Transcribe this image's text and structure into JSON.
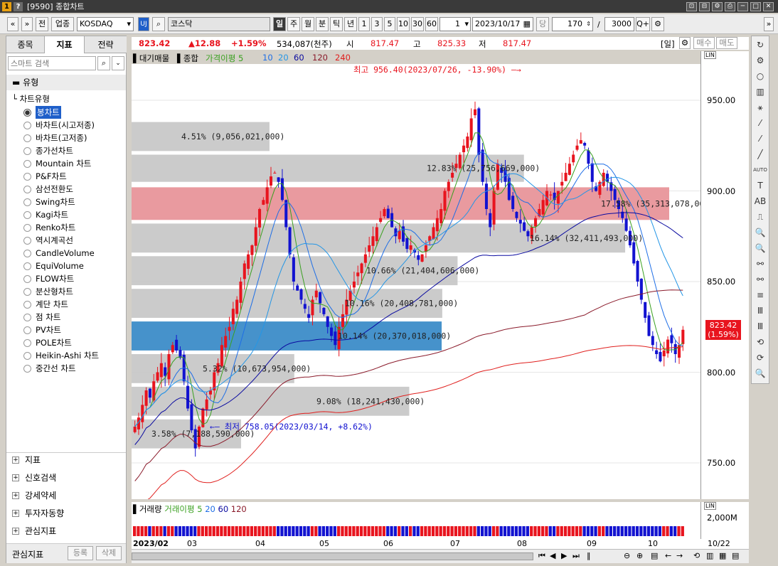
{
  "window": {
    "badge1": "1",
    "badge2": "?",
    "title": "[9590] 종합차트",
    "win_icons": [
      "⊡",
      "⊟",
      "⚙",
      "⎙",
      "─",
      "□",
      "✕"
    ]
  },
  "toolbar": {
    "nav_left": "«",
    "nav_down": "»",
    "btn_jeon": "전",
    "btn_upjong": "업종",
    "market_value": "KOSDAQ",
    "code_icon": "UJ",
    "search_icon": "⌕",
    "index_name": "코스닥",
    "periods": [
      "일",
      "주",
      "월",
      "분",
      "틱",
      "년"
    ],
    "counts": [
      "1",
      "3",
      "5",
      "10",
      "30",
      "60"
    ],
    "count_value": "1",
    "date_value": "2023/10/17",
    "btn_dang": "당",
    "view_count": "170",
    "slash": "/",
    "total_count": "3000",
    "zoom_icon": "Q+",
    "gear_icon": "⚙",
    "far_right": "»"
  },
  "leftpanel": {
    "tabs": [
      "종목",
      "지표",
      "전략"
    ],
    "search_placeholder": "스마트 검색",
    "group_label": "유형",
    "tree_label": "차트유형",
    "chart_types": [
      "봉차트",
      "바차트(시고저종)",
      "바차트(고저종)",
      "종가선차트",
      "Mountain 차트",
      "P&F차트",
      "삼선전환도",
      "Swing차트",
      "Kagi차트",
      "Renko차트",
      "역시계곡선",
      "CandleVolume",
      "EquiVolume",
      "FLOW차트",
      "분산형차트",
      "계단 차트",
      "점 차트",
      "PV차트",
      "POLE차트",
      "Heikin-Ashi 차트",
      "중간선 차트"
    ],
    "sections": [
      "지표",
      "신호검색",
      "강세약세",
      "투자자동향",
      "관심지표"
    ],
    "footer_label": "관심지표",
    "btn_register": "등록",
    "btn_delete": "삭제"
  },
  "infobar": {
    "price": "823.42",
    "change": "▲12.88",
    "pct": "+1.59%",
    "volume": "534,087(천주)",
    "open_label": "시",
    "open": "817.47",
    "high_label": "고",
    "high": "825.33",
    "low_label": "저",
    "low": "817.47",
    "period_tag": "[일]",
    "buy": "매수",
    "sell": "매도"
  },
  "legend": {
    "main": "▌대기매물",
    "composite": "▌종합",
    "ma_label": "가격이평 5",
    "ma10": "10",
    "ma20": "20",
    "ma60": "60",
    "ma120": "120",
    "ma240": "240"
  },
  "colors": {
    "up": "#e8141e",
    "down": "#1212d0",
    "ma5": "#3aa020",
    "ma10": "#1e6ee6",
    "ma20": "#2496e6",
    "ma60": "#0a0aa0",
    "ma120": "#8a1a2a",
    "ma240": "#e0201e",
    "profile": "#c8c8c8",
    "profile_hi": "#e8959a",
    "profile_cur": "#3c8cc8"
  },
  "chart_data": {
    "type": "candlestick",
    "ylim": [
      730,
      970
    ],
    "y_ticks": [
      "950.00",
      "900.00",
      "850.00",
      "800.00",
      "750.00"
    ],
    "y_tick_values": [
      950,
      900,
      850,
      800,
      750
    ],
    "months": [
      "2023/02",
      "03",
      "04",
      "05",
      "06",
      "07",
      "08",
      "09",
      "10"
    ],
    "right_date": "10/22",
    "current_price_label": "823.42",
    "current_pct_label": "(1.59%)",
    "annotations": {
      "high": "최고 956.40(2023/07/26, -13.90%)",
      "low": "최저 758.05(2023/03/14, +8.62%)"
    },
    "volume_profile": [
      {
        "lo": 922,
        "hi": 938,
        "pct": 4.51,
        "label": "4.51% (9,056,021,000)"
      },
      {
        "lo": 905,
        "hi": 920,
        "pct": 12.83,
        "label": "12.83% (25,756,669,000)"
      },
      {
        "lo": 884,
        "hi": 902,
        "pct": 17.58,
        "label": "17.58% (35,313,078,000)"
      },
      {
        "lo": 866,
        "hi": 882,
        "pct": 16.14,
        "label": "16.14% (32,411,493,000)"
      },
      {
        "lo": 848,
        "hi": 864,
        "pct": 10.66,
        "label": "10.66% (21,404,606,000)"
      },
      {
        "lo": 830,
        "hi": 846,
        "pct": 10.16,
        "label": "10.16% (20,408,781,000)"
      },
      {
        "lo": 812,
        "hi": 828,
        "pct": 10.14,
        "label": "10.14% (20,370,018,000)"
      },
      {
        "lo": 794,
        "hi": 810,
        "pct": 5.32,
        "label": "5.32% (10,673,954,000)"
      },
      {
        "lo": 776,
        "hi": 792,
        "pct": 9.08,
        "label": "9.08% (18,241,430,000)"
      },
      {
        "lo": 758,
        "hi": 774,
        "pct": 3.58,
        "label": "3.58% (7,188,590,000)"
      }
    ],
    "closes": [
      770,
      775,
      782,
      790,
      786,
      795,
      800,
      805,
      798,
      810,
      815,
      812,
      808,
      795,
      780,
      768,
      758,
      770,
      780,
      785,
      790,
      800,
      805,
      815,
      820,
      825,
      835,
      840,
      850,
      860,
      865,
      870,
      880,
      890,
      895,
      902,
      908,
      910,
      905,
      895,
      880,
      865,
      850,
      845,
      840,
      835,
      830,
      840,
      845,
      838,
      832,
      825,
      820,
      815,
      825,
      832,
      840,
      845,
      850,
      855,
      860,
      865,
      870,
      875,
      880,
      885,
      890,
      885,
      880,
      875,
      878,
      872,
      868,
      870,
      866,
      862,
      865,
      870,
      875,
      880,
      885,
      890,
      900,
      905,
      910,
      915,
      920,
      925,
      930,
      940,
      945,
      920,
      905,
      890,
      880,
      900,
      915,
      910,
      905,
      895,
      890,
      885,
      882,
      878,
      875,
      880,
      885,
      890,
      895,
      900,
      898,
      895,
      900,
      905,
      910,
      915,
      920,
      925,
      928,
      925,
      915,
      905,
      900,
      905,
      910,
      905,
      900,
      895,
      890,
      885,
      878,
      870,
      860,
      850,
      840,
      830,
      820,
      815,
      810,
      806,
      812,
      818,
      816,
      810,
      815,
      823.42
    ],
    "legend_vol": {
      "label": "▌거래량",
      "ma_label": "거래이평 5",
      "m20": "20",
      "m60": "60",
      "m120": "120",
      "tick": "2,000M"
    }
  },
  "right_tools": [
    "↻",
    "⚙",
    "○",
    "▥",
    "⚹",
    "⁄",
    "⁄",
    "╱",
    "AUTO",
    "T",
    "AB",
    "⎍",
    "🔍",
    "🔍",
    "⚯",
    "⚯",
    "≡",
    "Ⅲ",
    "Ⅲ",
    "⟲",
    "⟳",
    "🔍"
  ]
}
